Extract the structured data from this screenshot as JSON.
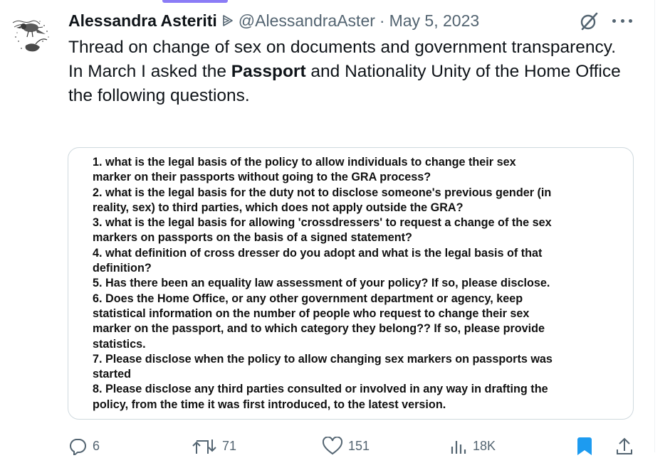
{
  "tweet": {
    "display_name": "Alessandra Asteriti",
    "handle": "@AlessandraAster",
    "date": "May 5, 2023",
    "text_line1": "Thread on change of sex on documents and government transparency.",
    "text_line2_pre": "In March I asked the ",
    "text_line2_bold": "Passport",
    "text_line2_post": " and Nationality Unity of the Home Office the following questions."
  },
  "document_lines": [
    "1. what is the legal basis of the policy to allow individuals to change their sex",
    "marker on their passports without going to the GRA process?",
    "2. what is the legal basis for the duty not to disclose someone's previous gender (in",
    "reality, sex) to third parties, which does not apply outside the GRA?",
    "3. what is the legal basis for allowing 'crossdressers' to request a change of the sex",
    "markers on passports on the basis of a signed statement?",
    "4. what definition of cross dresser do you adopt and what is the legal basis of that",
    "definition?",
    "5. Has there been an equality law assessment of your policy? If so, please disclose.",
    "6. Does the Home Office, or any other government department or agency, keep",
    "statistical information on the number of people who request to change their sex",
    "marker on the passport, and to which category they belong?? If so, please provide",
    "statistics.",
    "7. Please disclose when the policy to allow changing sex markers on passports was",
    "started",
    "8. Please disclose any third parties consulted or involved in any way in drafting the",
    "policy, from the time it was first introduced, to the latest version."
  ],
  "actions": {
    "replies": "6",
    "reposts": "71",
    "likes": "151",
    "views": "18K"
  },
  "icons": {
    "reply": "reply-icon",
    "repost": "repost-icon",
    "like": "heart-icon",
    "views": "views-icon",
    "bookmark": "bookmark-icon",
    "share": "share-icon",
    "grok": "grok-icon",
    "more": "more-icon",
    "badge": "parody-badge-icon"
  },
  "colors": {
    "text": "#0f1419",
    "secondary": "#536471",
    "bookmark": "#1d9bf0",
    "accent_bar": "#8b7cf6",
    "border": "#cfd9de"
  }
}
